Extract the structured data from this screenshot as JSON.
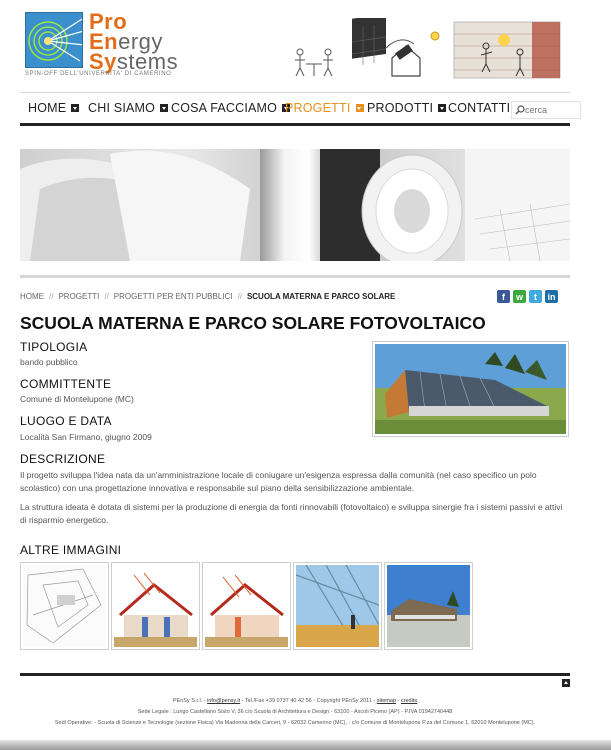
{
  "brand": {
    "logo_line1_a": "Pro",
    "logo_line2_a": "En",
    "logo_line2_b": "ergy",
    "logo_line3_a": "Sy",
    "logo_line3_b": "stems",
    "tagline": "SPIN-OFF DELL'UNIVERSITA' DI CAMERINO"
  },
  "nav": {
    "items": [
      {
        "label": "HOME",
        "dropdown": true
      },
      {
        "label": "CHI SIAMO",
        "dropdown": true
      },
      {
        "label": "COSA FACCIAMO",
        "dropdown": true
      },
      {
        "label": "PROGETTI",
        "dropdown": true,
        "active": true
      },
      {
        "label": "PRODOTTI",
        "dropdown": true
      },
      {
        "label": "CONTATTI",
        "dropdown": false
      }
    ],
    "search_placeholder": "cerca",
    "accent_color": "#e8901c"
  },
  "breadcrumb": {
    "items": [
      "HOME",
      "PROGETTI",
      "PROGETTI PER ENTI PUBBLICI"
    ],
    "current": "SCUOLA MATERNA E PARCO SOLARE",
    "separator": "//"
  },
  "social": [
    {
      "icon": "facebook-icon",
      "glyph": "f",
      "color": "#3b5998"
    },
    {
      "icon": "whatsapp-icon",
      "glyph": "w",
      "color": "#3aa83a"
    },
    {
      "icon": "twitter-icon",
      "glyph": "t",
      "color": "#3fa9e0"
    },
    {
      "icon": "linkedin-icon",
      "glyph": "in",
      "color": "#1d6fa5"
    }
  ],
  "project": {
    "title": "SCUOLA MATERNA E PARCO SOLARE FOTOVOLTAICO",
    "tipologia_h": "TIPOLOGIA",
    "tipologia": "bando pubblico",
    "committente_h": "COMMITTENTE",
    "committente": "Comune di Montelupone (MC)",
    "luogo_h": "LUOGO E DATA",
    "luogo": "Località San Firmano, giugno 2009",
    "descrizione_h": "DESCRIZIONE",
    "descrizione_p1": "Il progetto sviluppa l'idea nata da un'amministrazione locale di coniugare un'esigenza espressa dalla comunità (nel caso specifico un polo scolastico) con una progettazione innovativa e responsabile sul piano della sensibilizzazione ambientale.",
    "descrizione_p2": "La struttura ideata è dotata di sistemi per la produzione di energia da fonti rinnovabili (fotovoltaico) e sviluppa sinergie fra i sistemi passivi e attivi di risparmio energetico.",
    "altre_h": "ALTRE IMMAGINI"
  },
  "footer": {
    "line1_a": "PEnSy S.r.l. - ",
    "email": "info@pensy.it",
    "line1_b": " - Tel./Fax +39 0737 40 42 56 - Copyright PEnSy 2011 - ",
    "sitemap": "sitemap",
    "line1_c": " - ",
    "credits": "credits",
    "line2": "Sede Legale : Lungo Castellano Sisto V, 36 c/o Scuola di Architettura e Design - 63100 - Ascoli Piceno (AP) - P.IVA 01942740448",
    "line3": "Sedi Operative: - Scuola di Scienze e Tecnologie (sezione Fisica) Via Madonna delle Carceri, 9 - 62032 Camerino (MC), - c/o Comune di Montelupone P.za del Comune 1, 62010 Montelupone (MC)."
  }
}
